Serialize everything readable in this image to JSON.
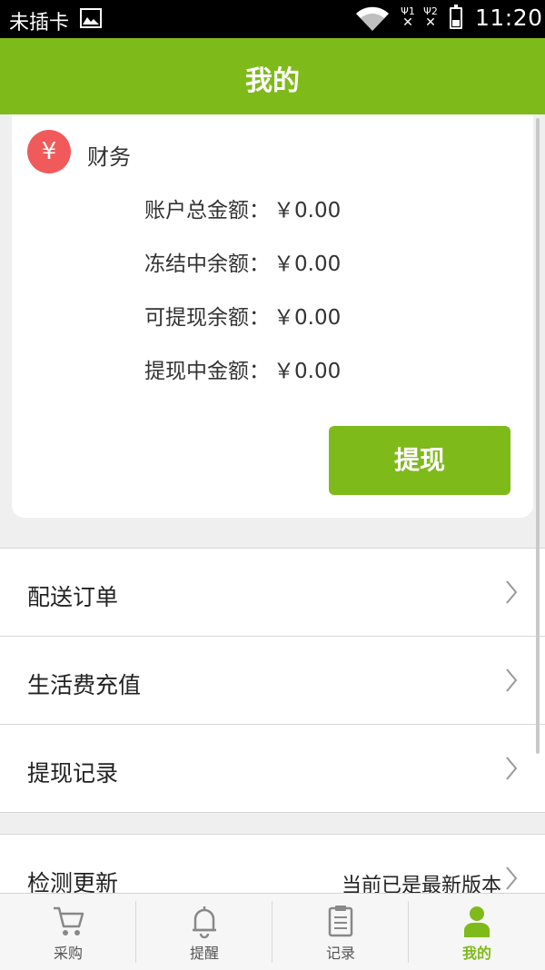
{
  "status_bar": {
    "carrier": "未插卡",
    "sim1": "1",
    "sim2": "2",
    "time": "11:20"
  },
  "header": {
    "title": "我的"
  },
  "finance": {
    "icon_glyph": "¥",
    "label": "财务",
    "rows": [
      {
        "label": "账户总金额：",
        "value": "￥0.00"
      },
      {
        "label": "冻结中余额：",
        "value": "￥0.00"
      },
      {
        "label": "可提现余额：",
        "value": "￥0.00"
      },
      {
        "label": "提现中金额：",
        "value": "￥0.00"
      }
    ],
    "withdraw_button": "提现"
  },
  "menu": [
    {
      "label": "配送订单"
    },
    {
      "label": "生活费充值"
    },
    {
      "label": "提现记录"
    }
  ],
  "update": {
    "label": "检测更新",
    "status": "当前已是最新版本"
  },
  "tabs": [
    {
      "label": "采购",
      "icon": "cart-icon"
    },
    {
      "label": "提醒",
      "icon": "bell-icon"
    },
    {
      "label": "记录",
      "icon": "clipboard-icon"
    },
    {
      "label": "我的",
      "icon": "person-icon",
      "active": true
    }
  ],
  "colors": {
    "brand": "#7fba1b",
    "finance_icon": "#f05a5a"
  }
}
